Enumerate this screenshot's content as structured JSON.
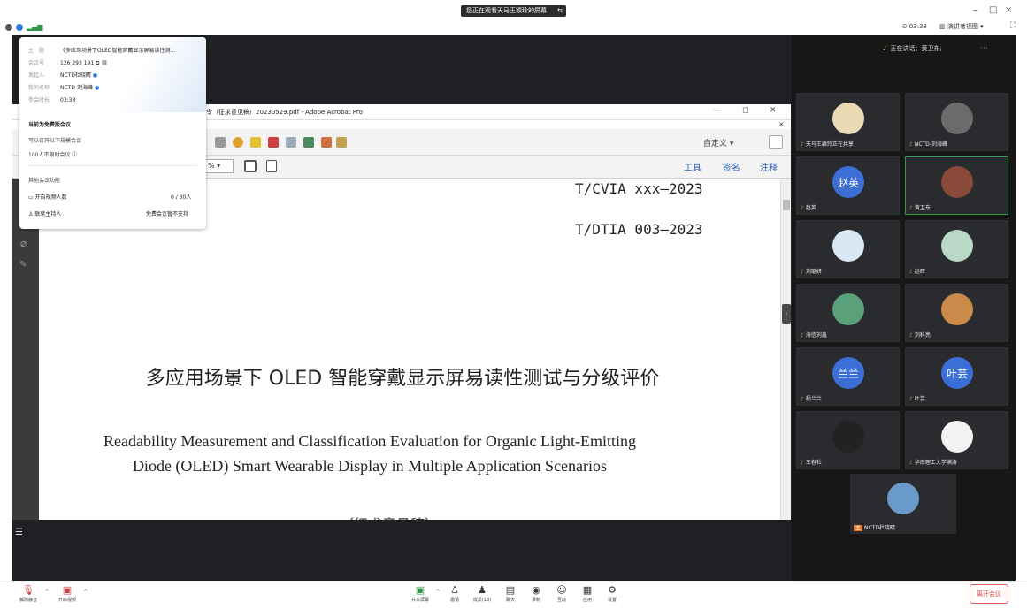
{
  "top": {
    "share_banner": "您正在观看天马王颖玲的屏幕",
    "timer": "03:38",
    "view_mode": "演讲者视图",
    "window_minimize": "–",
    "window_restore": "□",
    "window_close": "×"
  },
  "meeting_info": {
    "topic_key": "主　题",
    "topic_val": "《多应用场景下OLED智能穿戴显示屏易读性测...",
    "id_key": "会议号",
    "id_val": "126 293 191",
    "host_key": "发起人",
    "host_val": "NCTD杜晓睛",
    "myname_key": "我的名称",
    "myname_val": "NCTD-刘海峰",
    "duration_key": "参会时长",
    "duration_val": "03:38",
    "free_title": "当前为免费版会议",
    "free_sub": "可以召开以下规模会议",
    "free_item": "100人不限时会议 ⓘ",
    "other_title": "其他会议功能",
    "video_label": "开启视频人数",
    "video_val": "0 / 30人",
    "cohost_label": "联席主持人",
    "cohost_val": "免费会议暂不支持"
  },
  "acrobat": {
    "title": "令（征求意见稿）20230529.pdf - Adobe Acrobat Pro",
    "customize": "自定义 ▾",
    "zoom": "% ▾",
    "tab_tools": "工具",
    "tab_sign": "签名",
    "tab_comment": "注释",
    "std1": "T/CVIA xxx—2023",
    "std2": "T/DTIA 003—2023",
    "title_cn": "多应用场景下 OLED 智能穿戴显示屏易读性测试与分级评价",
    "title_en_1": "Readability Measurement and Classification Evaluation for Organic Light-Emitting",
    "title_en_2": "Diode (OLED) Smart Wearable Display in Multiple Application Scenarios",
    "cut_text": "（征求意见稿）"
  },
  "speaking": {
    "label": "正在讲话：黄卫东;"
  },
  "participants": [
    {
      "name": "天马王颖玲正在共享",
      "avatar_text": "",
      "color": "#e9d9b5"
    },
    {
      "name": "NCTD-刘海峰",
      "avatar_text": "",
      "color": "#6b6b6b"
    },
    {
      "name": "赵英",
      "avatar_text": "赵英",
      "color": "#3b6fd6"
    },
    {
      "name": "黄卫东",
      "avatar_text": "",
      "color": "#8a4a3a"
    },
    {
      "name": "刘璐妍",
      "avatar_text": "",
      "color": "#d9e8f4"
    },
    {
      "name": "赵辉",
      "avatar_text": "",
      "color": "#b9d8c8"
    },
    {
      "name": "海信刘鑫",
      "avatar_text": "",
      "color": "#5aa07a"
    },
    {
      "name": "刘科亮",
      "avatar_text": "",
      "color": "#c98a4a"
    },
    {
      "name": "杨兰兰",
      "avatar_text": "兰兰",
      "color": "#3b6fd6"
    },
    {
      "name": "叶芸",
      "avatar_text": "叶芸",
      "color": "#3b6fd6"
    },
    {
      "name": "王春社",
      "avatar_text": "",
      "color": "#222222"
    },
    {
      "name": "华南理工大学满涛",
      "avatar_text": "",
      "color": "#f2f2f2"
    }
  ],
  "self_tile": {
    "name": "NCTD杜晓睛",
    "badge": "主"
  },
  "bottom": {
    "mute": "解除静音",
    "video": "开启视频",
    "share": "共享屏幕",
    "invite": "邀请",
    "members": "成员(13)",
    "chat": "聊天",
    "record": "录制",
    "interact": "互动",
    "apps": "应用",
    "settings": "设置",
    "leave": "离开会议"
  },
  "colors": {
    "stage": "#1f2023",
    "panel": "#171718",
    "active_border": "#2f9a4a",
    "accent_blue": "#3b6fd6",
    "leave_red": "#e04040"
  }
}
